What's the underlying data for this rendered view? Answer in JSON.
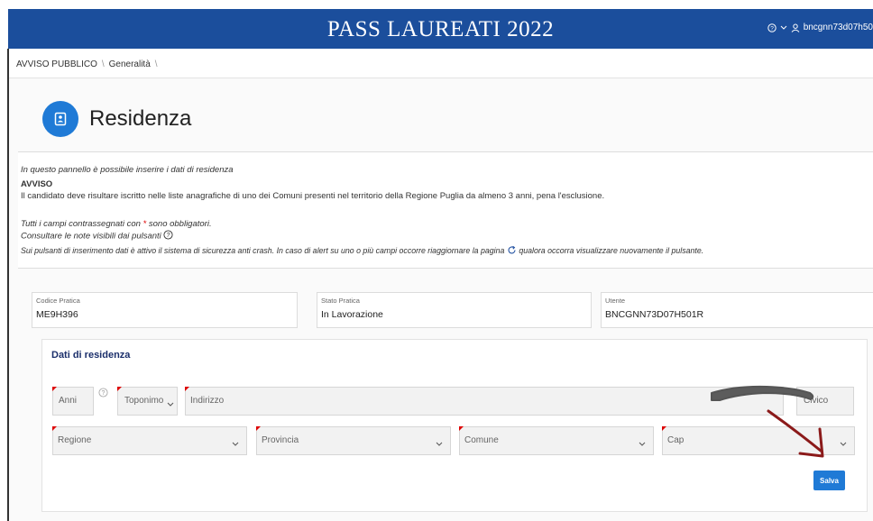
{
  "header": {
    "title": "PASS LAUREATI 2022",
    "username": "bncgnn73d07h50"
  },
  "breadcrumb": {
    "item1": "AVVISO PUBBLICO",
    "item2": "Generalità"
  },
  "page": {
    "title": "Residenza"
  },
  "notice": {
    "intro": "In questo pannello è possibile inserire i dati di residenza",
    "heading": "AVVISO",
    "body": "Il candidato deve risultare iscritto nelle liste anagrafiche di uno dei Comuni presenti nel territorio della Regione Puglia da almeno 3 anni, pena l'esclusione.",
    "required_pre": "Tutti i campi contrassegnati con",
    "required_mark": "*",
    "required_post": "sono obbligatori.",
    "help_note": "Consultare le note visibili dai pulsanti",
    "crash_pre": "Sui pulsanti di inserimento dati è attivo il sistema di sicurezza anti crash. In caso di alert su uno o più campi occorre riaggiornare la pagina",
    "crash_post": "qualora occorra visualizzare nuovamente il pulsante."
  },
  "info_fields": [
    {
      "label": "Codice Pratica",
      "value": "ME9H396"
    },
    {
      "label": "Stato Pratica",
      "value": "In Lavorazione"
    },
    {
      "label": "Utente",
      "value": "BNCGNN73D07H501R"
    }
  ],
  "form": {
    "title": "Dati di residenza",
    "anni": "Anni",
    "toponimo": "Toponimo",
    "indirizzo": "Indirizzo",
    "civico": "Civico",
    "regione": "Regione",
    "provincia": "Provincia",
    "comune": "Comune",
    "cap": "Cap",
    "save_label": "Salva"
  },
  "colors": {
    "header": "#1b4e9c",
    "accent": "#1f7ad6",
    "required": "#dd0000",
    "annotation": "#8b1a1a"
  }
}
